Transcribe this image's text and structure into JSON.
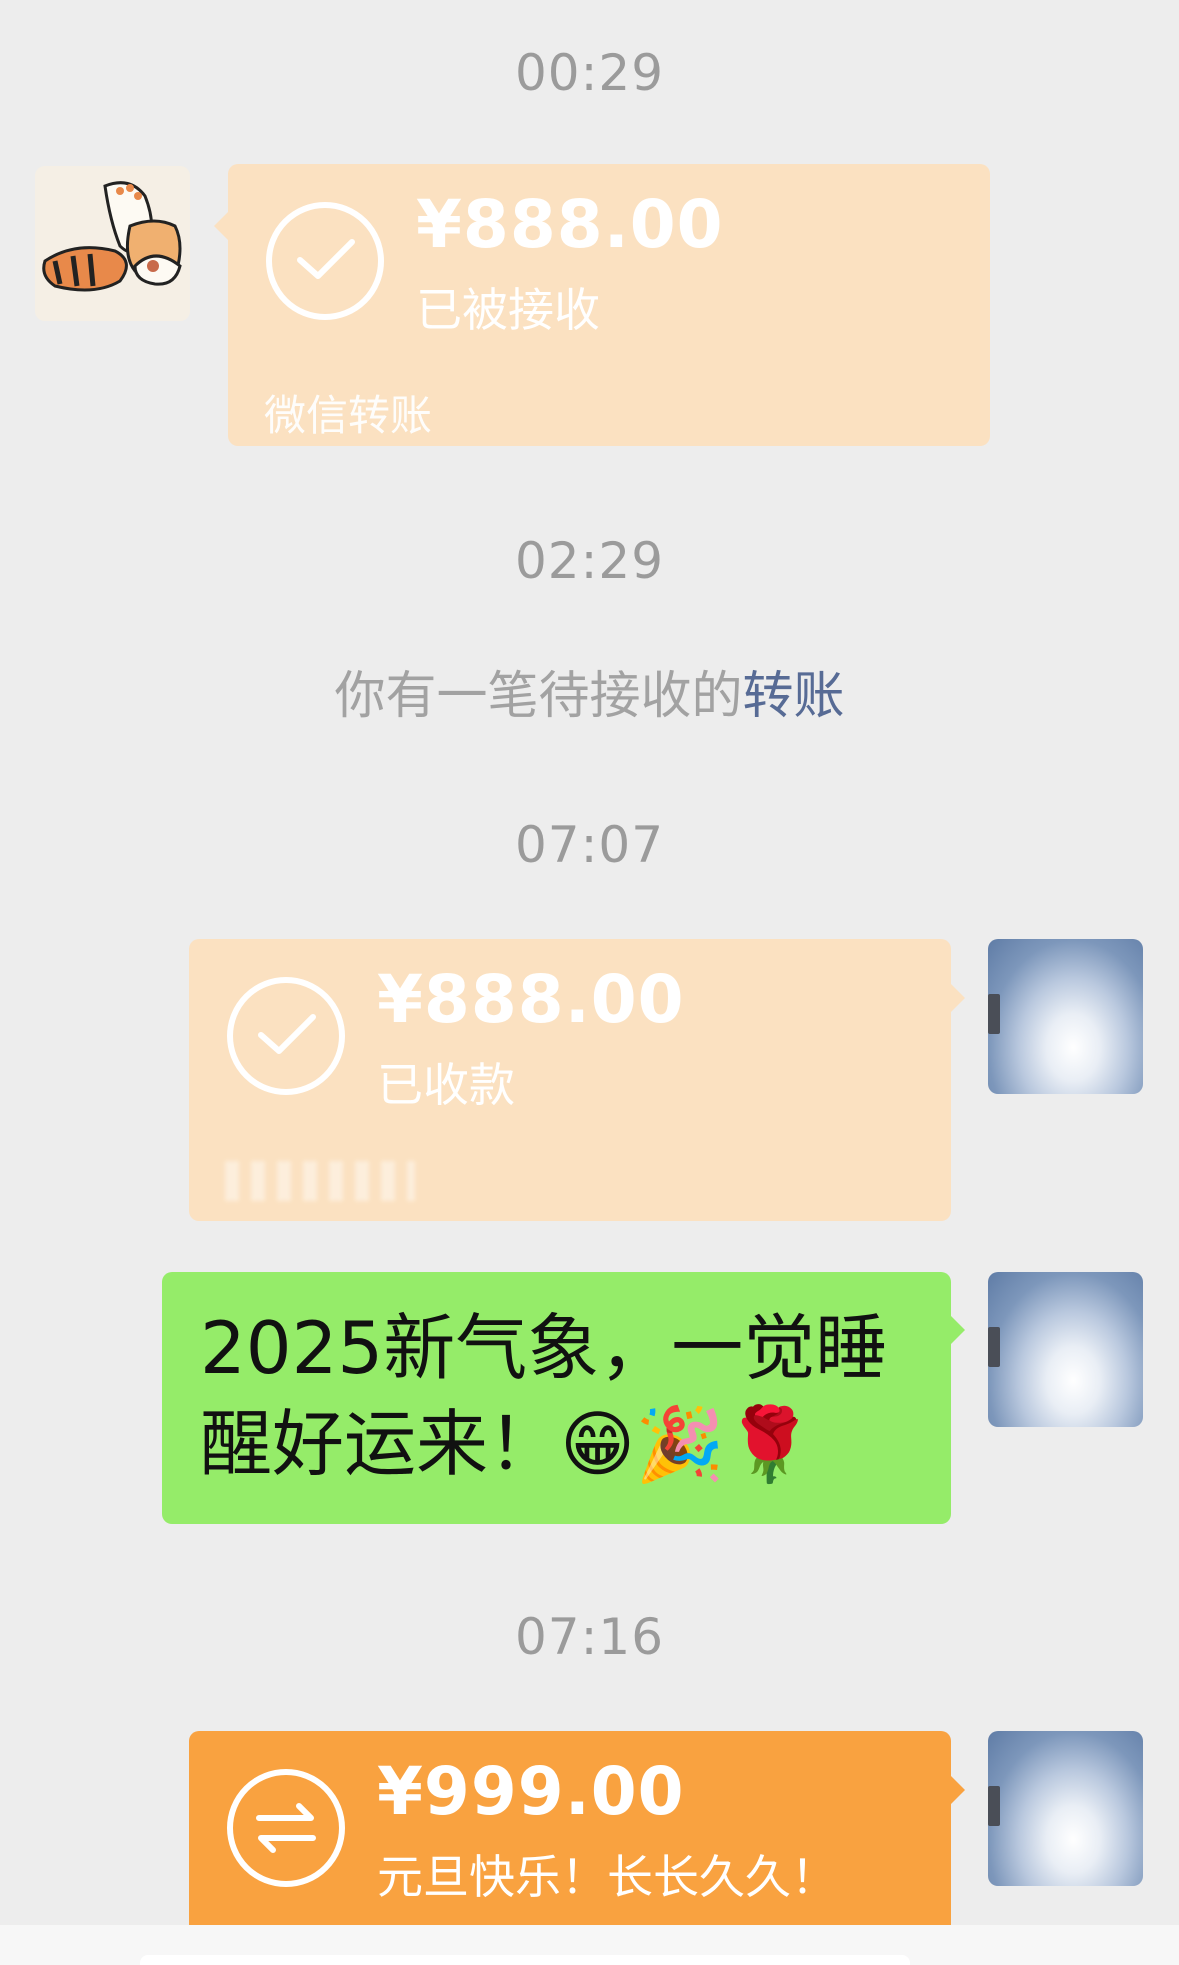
{
  "messages": {
    "t1": "00:29",
    "t2": "02:29",
    "t3": "07:07",
    "t4": "07:16",
    "transfer1": {
      "amount": "¥888.00",
      "status": "已被接收",
      "footer": "微信转账"
    },
    "system_notice": {
      "text": "你有一笔待接收的",
      "link": "转账"
    },
    "transfer2": {
      "amount": "¥888.00",
      "status": "已收款"
    },
    "text_message": {
      "line1": "2025新气象，一觉睡",
      "line2": "醒好运来！😁🎉🌹"
    },
    "transfer3": {
      "amount": "¥999.00",
      "note": "元旦快乐！长长久久！"
    }
  },
  "colors": {
    "background": "#ededed",
    "transfer_received": "#fbe1c1",
    "transfer_pending": "#f9a240",
    "text_bubble": "#95ec69",
    "link": "#576b95"
  },
  "icons": {
    "check": "check-circle-icon",
    "transfer": "transfer-arrows-icon"
  }
}
